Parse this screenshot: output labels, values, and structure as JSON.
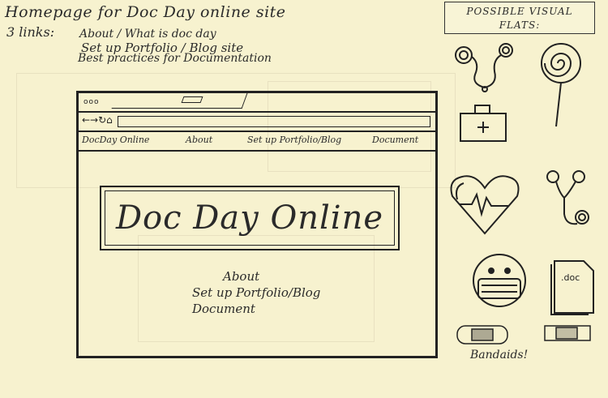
{
  "notes": {
    "title": "Homepage for Doc Day online site",
    "links_prefix": "3 links:",
    "link_1": "About / What is doc day",
    "link_2": "Set up Portfolio / Blog site",
    "link_3": "Best practices for Documentation"
  },
  "visuals_box": {
    "line1": "POSSIBLE VISUAL",
    "line2": "FLATS:"
  },
  "browser": {
    "dots": "ooo",
    "nav_arrows": "←→↻⌂",
    "menu": {
      "site": "DocDay Online",
      "about": "About",
      "setup": "Set up Portfolio/Blog",
      "document": "Document"
    },
    "hero_title": "Doc Day Online",
    "body_links": [
      "About",
      "Set up Portfolio/Blog",
      "Document"
    ]
  },
  "icons": [
    "stethoscope-icon",
    "lollipop-icon",
    "first-aid-kit-icon",
    "heart-ekg-icon",
    "stethoscope-icon",
    "face-mask-icon",
    "doc-file-icon",
    "bandaid-icon"
  ],
  "caption": "Bandaids!",
  "doc_label": ".doc"
}
